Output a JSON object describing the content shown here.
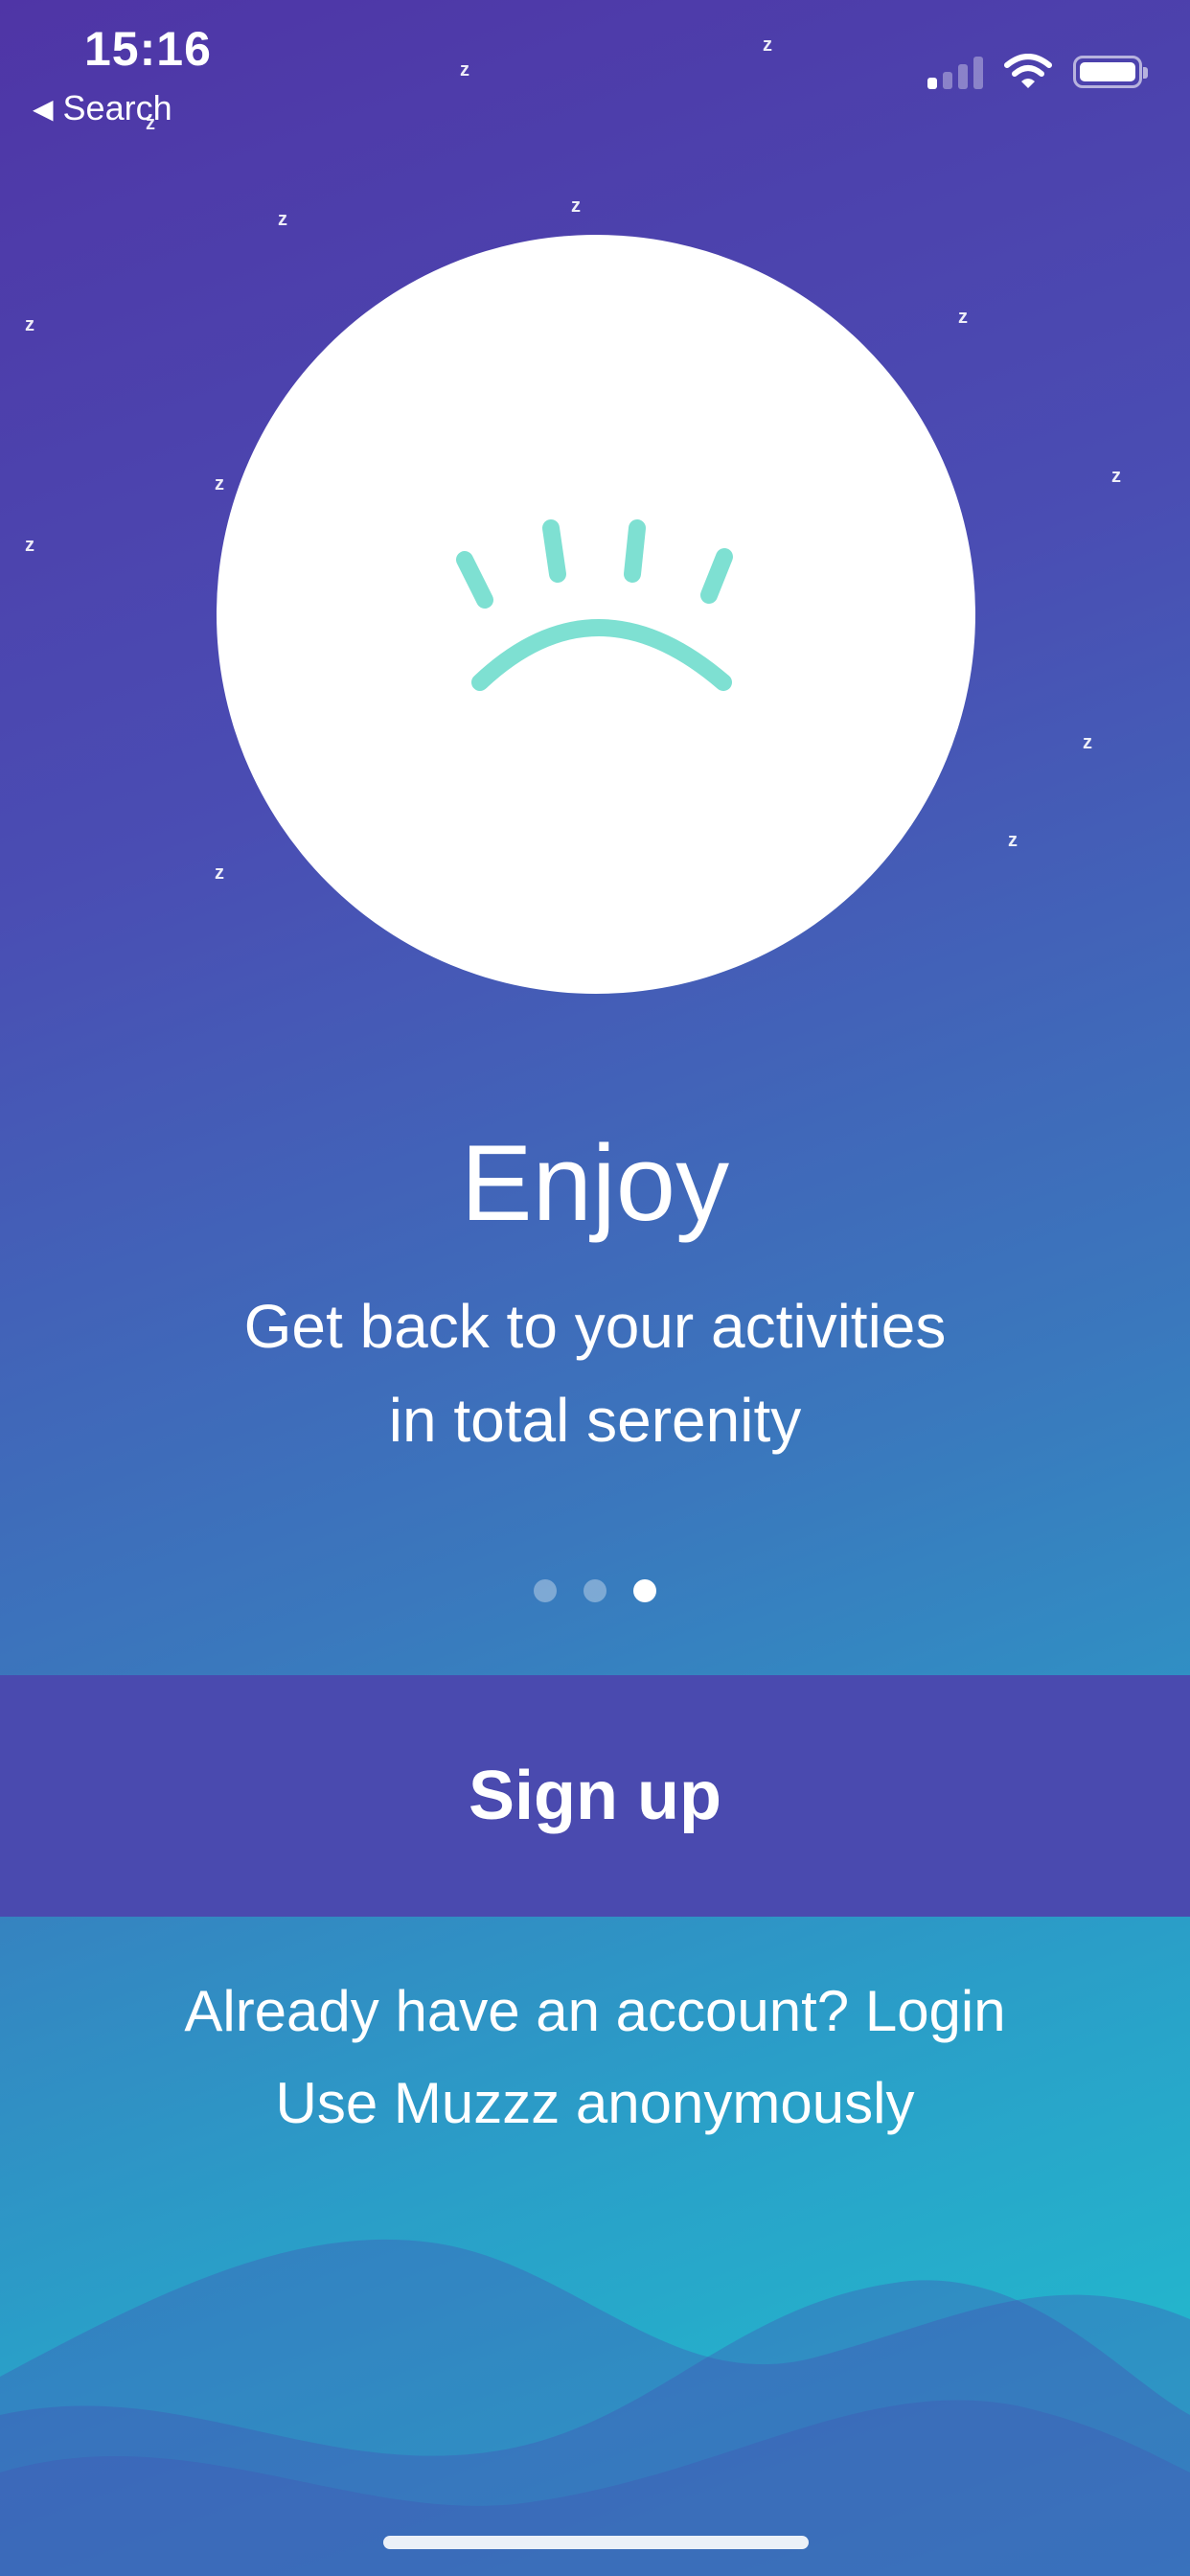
{
  "status_bar": {
    "time": "15:16",
    "back_label": "Search",
    "back_icon": "back-triangle-icon",
    "signal_icon": "cellular-signal-icon",
    "wifi_icon": "wifi-icon",
    "battery_icon": "battery-icon"
  },
  "onboarding": {
    "illustration": "sleeping-eye-icon",
    "title": "Enjoy",
    "subtitle_line1": "Get back to your activities",
    "subtitle_line2": "in total serenity",
    "page_count": 3,
    "current_page": 3
  },
  "actions": {
    "signup_label": "Sign up",
    "login_label": "Already have an account? Login",
    "anonymous_label": "Use Muzzz anonymously"
  },
  "decorations": {
    "z_glyph": "z"
  },
  "colors": {
    "signup_bg": "#4a4aaf",
    "eye_stroke": "#7ee0d2",
    "gradient_top": "#4f35a6",
    "gradient_bottom": "#1fc3cf"
  }
}
